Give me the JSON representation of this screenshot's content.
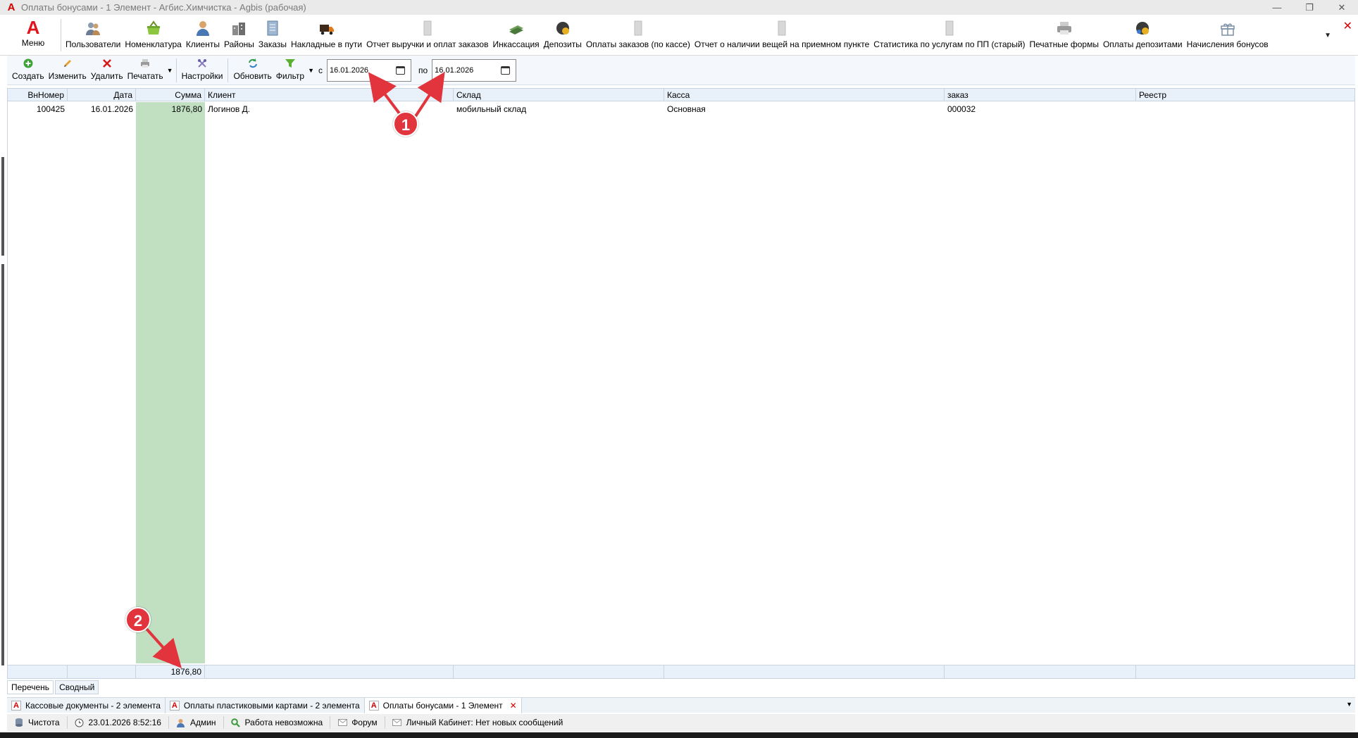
{
  "window": {
    "title": "Оплаты бонусами - 1 Элемент - Агбис.Химчистка - Agbis (рабочая)",
    "app_logo": "A",
    "minimize": "—",
    "restore": "❐",
    "close": "✕"
  },
  "main_menu": {
    "menu_icon": "A",
    "menu_label": "Меню",
    "items": [
      {
        "label": "Пользователи",
        "icon": "users-icon"
      },
      {
        "label": "Номенклатура",
        "icon": "basket-icon"
      },
      {
        "label": "Клиенты",
        "icon": "client-icon"
      },
      {
        "label": "Районы",
        "icon": "district-icon"
      },
      {
        "label": "Заказы",
        "icon": "orders-icon"
      },
      {
        "label": "Накладные в пути",
        "icon": "truck-icon"
      },
      {
        "label": "Отчет выручки и оплат заказов",
        "icon": "report-icon"
      },
      {
        "label": "Инкассация",
        "icon": "cash-icon"
      },
      {
        "label": "Депозиты",
        "icon": "deposit-icon"
      },
      {
        "label": "Оплаты заказов (по кассе)",
        "icon": "report-icon"
      },
      {
        "label": "Отчет о наличии вещей на приемном пункте",
        "icon": "report-icon"
      },
      {
        "label": "Статистика по услугам по ПП (старый)",
        "icon": "report-icon"
      },
      {
        "label": "Печатные формы",
        "icon": "printer-icon"
      },
      {
        "label": "Оплаты депозитами",
        "icon": "deposit-icon"
      },
      {
        "label": "Начисления бонусов",
        "icon": "gift-icon"
      }
    ],
    "overflow": "▼",
    "close": "✕"
  },
  "toolbar": {
    "create": "Создать",
    "edit": "Изменить",
    "delete": "Удалить",
    "print": "Печатать",
    "print_dropdown": "▼",
    "settings": "Настройки",
    "refresh": "Обновить",
    "filter": "Фильтр",
    "filter_dropdown": "▼",
    "from_label": "с",
    "from_date": "16.01.2026",
    "to_label": "по",
    "to_date": "16.01.2026"
  },
  "grid": {
    "columns": [
      "ВнНомер",
      "Дата",
      "Сумма",
      "Клиент",
      "Склад",
      "Касса",
      "заказ",
      "Реестр"
    ],
    "rows": [
      {
        "num": "100425",
        "date": "16.01.2026",
        "sum": "1876,80",
        "client": "Логинов Д.",
        "warehouse": "мобильный склад",
        "cashbox": "Основная",
        "order": "000032",
        "registry": ""
      }
    ],
    "total_sum": "1876,80"
  },
  "view_tabs": [
    "Перечень",
    "Сводный"
  ],
  "doc_tabs": [
    {
      "label": "Кассовые документы - 2 элемента"
    },
    {
      "label": "Оплаты пластиковыми картами - 2 элемента"
    },
    {
      "label": "Оплаты бонусами - 1 Элемент"
    }
  ],
  "doc_tabs_close": "✕",
  "doc_tabs_overflow": "▼",
  "status": {
    "db": "Чистота",
    "datetime": "23.01.2026 8:52:16",
    "user": "Админ",
    "work": "Работа невозможна",
    "forum": "Форум",
    "cabinet": "Личный Кабинет: Нет новых сообщений"
  },
  "annotations": [
    "1",
    "2"
  ],
  "colors": {
    "accent_red": "#e0141e",
    "sum_highlight": "#c1dfc1",
    "badge": "#e2343c"
  }
}
